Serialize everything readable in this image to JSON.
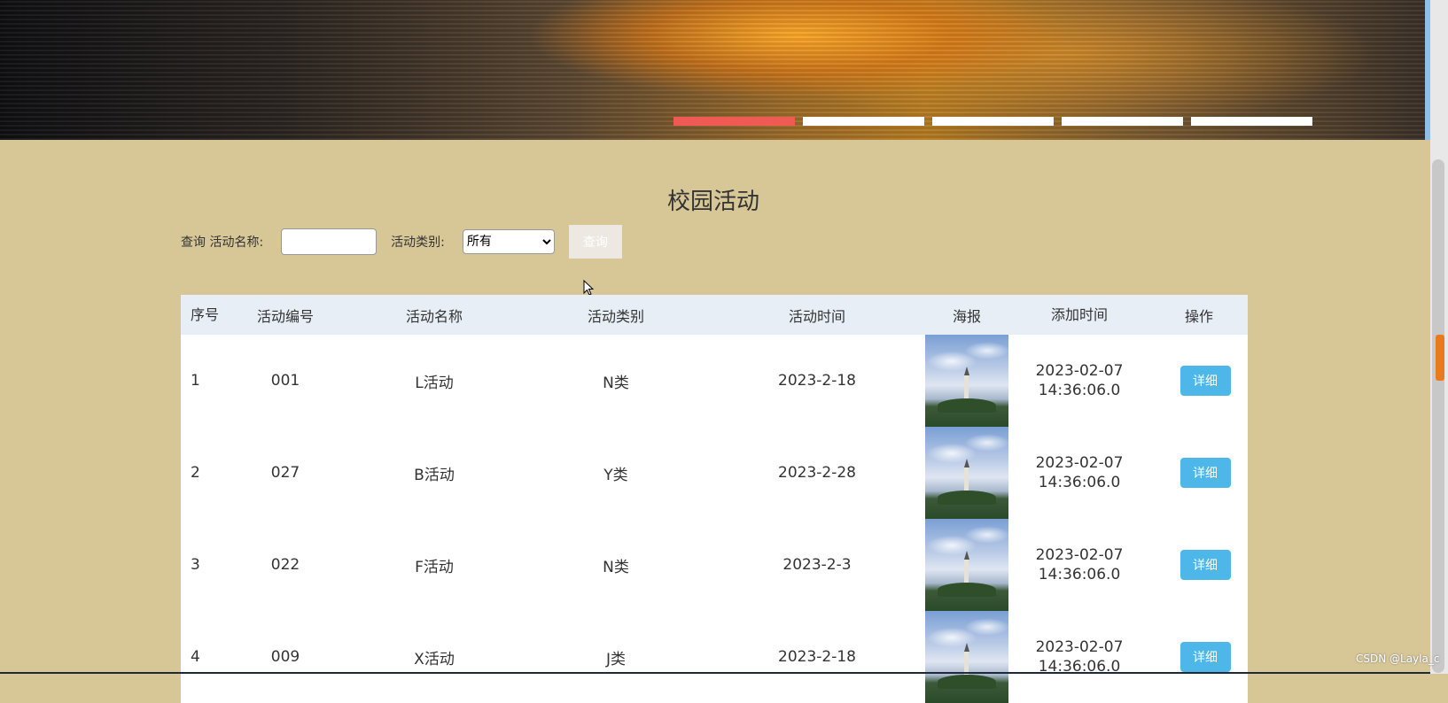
{
  "banner": {
    "slides": 5,
    "active_slide": 1
  },
  "page": {
    "title": "校园活动"
  },
  "search": {
    "query_label": "查询 活动名称:",
    "name_value": "",
    "category_label": "活动类别:",
    "category_selected": "所有",
    "button_label": "查询"
  },
  "table": {
    "headers": [
      "序号",
      "活动编号",
      "活动名称",
      "活动类别",
      "活动时间",
      "海报",
      "添加时间",
      "操作"
    ],
    "rows": [
      {
        "index": "1",
        "code": "001",
        "name": "L活动",
        "category": "N类",
        "time": "2023-2-18",
        "added_date": "2023-02-07",
        "added_time": "14:36:06.0",
        "action": "详细"
      },
      {
        "index": "2",
        "code": "027",
        "name": "B活动",
        "category": "Y类",
        "time": "2023-2-28",
        "added_date": "2023-02-07",
        "added_time": "14:36:06.0",
        "action": "详细"
      },
      {
        "index": "3",
        "code": "022",
        "name": "F活动",
        "category": "N类",
        "time": "2023-2-3",
        "added_date": "2023-02-07",
        "added_time": "14:36:06.0",
        "action": "详细"
      },
      {
        "index": "4",
        "code": "009",
        "name": "X活动",
        "category": "J类",
        "time": "2023-2-18",
        "added_date": "2023-02-07",
        "added_time": "14:36:06.0",
        "action": "详细"
      }
    ]
  },
  "watermark": "CSDN @Layla_c"
}
